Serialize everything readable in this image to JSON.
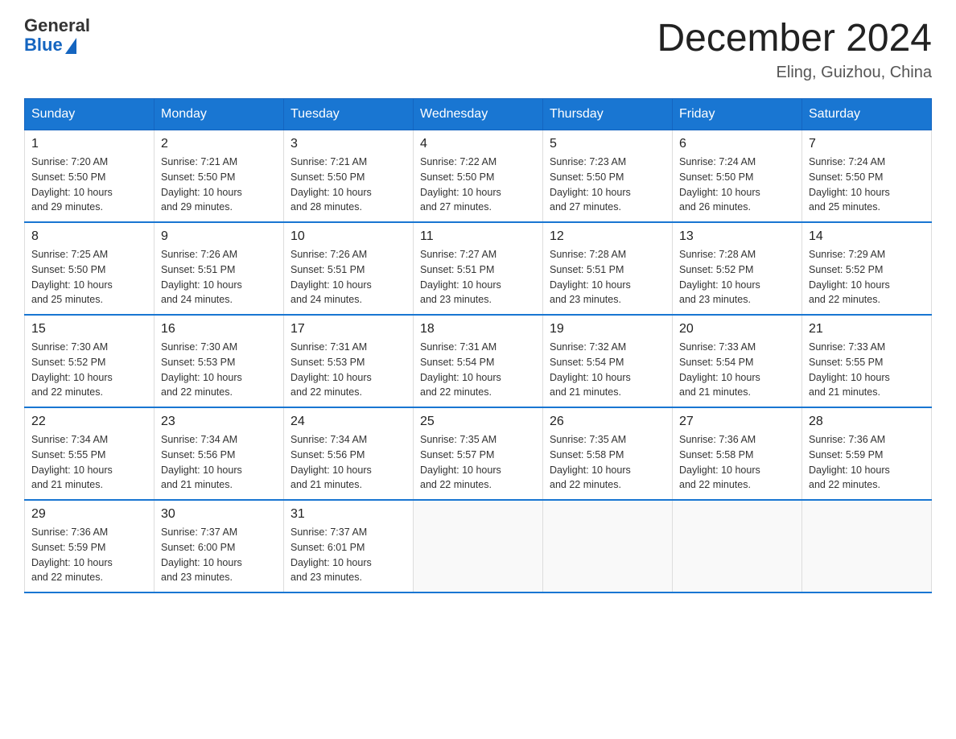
{
  "header": {
    "logo_general": "General",
    "logo_blue": "Blue",
    "month_title": "December 2024",
    "location": "Eling, Guizhou, China"
  },
  "days_of_week": [
    "Sunday",
    "Monday",
    "Tuesday",
    "Wednesday",
    "Thursday",
    "Friday",
    "Saturday"
  ],
  "weeks": [
    [
      {
        "day": "1",
        "sunrise": "7:20 AM",
        "sunset": "5:50 PM",
        "daylight": "10 hours and 29 minutes."
      },
      {
        "day": "2",
        "sunrise": "7:21 AM",
        "sunset": "5:50 PM",
        "daylight": "10 hours and 29 minutes."
      },
      {
        "day": "3",
        "sunrise": "7:21 AM",
        "sunset": "5:50 PM",
        "daylight": "10 hours and 28 minutes."
      },
      {
        "day": "4",
        "sunrise": "7:22 AM",
        "sunset": "5:50 PM",
        "daylight": "10 hours and 27 minutes."
      },
      {
        "day": "5",
        "sunrise": "7:23 AM",
        "sunset": "5:50 PM",
        "daylight": "10 hours and 27 minutes."
      },
      {
        "day": "6",
        "sunrise": "7:24 AM",
        "sunset": "5:50 PM",
        "daylight": "10 hours and 26 minutes."
      },
      {
        "day": "7",
        "sunrise": "7:24 AM",
        "sunset": "5:50 PM",
        "daylight": "10 hours and 25 minutes."
      }
    ],
    [
      {
        "day": "8",
        "sunrise": "7:25 AM",
        "sunset": "5:50 PM",
        "daylight": "10 hours and 25 minutes."
      },
      {
        "day": "9",
        "sunrise": "7:26 AM",
        "sunset": "5:51 PM",
        "daylight": "10 hours and 24 minutes."
      },
      {
        "day": "10",
        "sunrise": "7:26 AM",
        "sunset": "5:51 PM",
        "daylight": "10 hours and 24 minutes."
      },
      {
        "day": "11",
        "sunrise": "7:27 AM",
        "sunset": "5:51 PM",
        "daylight": "10 hours and 23 minutes."
      },
      {
        "day": "12",
        "sunrise": "7:28 AM",
        "sunset": "5:51 PM",
        "daylight": "10 hours and 23 minutes."
      },
      {
        "day": "13",
        "sunrise": "7:28 AM",
        "sunset": "5:52 PM",
        "daylight": "10 hours and 23 minutes."
      },
      {
        "day": "14",
        "sunrise": "7:29 AM",
        "sunset": "5:52 PM",
        "daylight": "10 hours and 22 minutes."
      }
    ],
    [
      {
        "day": "15",
        "sunrise": "7:30 AM",
        "sunset": "5:52 PM",
        "daylight": "10 hours and 22 minutes."
      },
      {
        "day": "16",
        "sunrise": "7:30 AM",
        "sunset": "5:53 PM",
        "daylight": "10 hours and 22 minutes."
      },
      {
        "day": "17",
        "sunrise": "7:31 AM",
        "sunset": "5:53 PM",
        "daylight": "10 hours and 22 minutes."
      },
      {
        "day": "18",
        "sunrise": "7:31 AM",
        "sunset": "5:54 PM",
        "daylight": "10 hours and 22 minutes."
      },
      {
        "day": "19",
        "sunrise": "7:32 AM",
        "sunset": "5:54 PM",
        "daylight": "10 hours and 21 minutes."
      },
      {
        "day": "20",
        "sunrise": "7:33 AM",
        "sunset": "5:54 PM",
        "daylight": "10 hours and 21 minutes."
      },
      {
        "day": "21",
        "sunrise": "7:33 AM",
        "sunset": "5:55 PM",
        "daylight": "10 hours and 21 minutes."
      }
    ],
    [
      {
        "day": "22",
        "sunrise": "7:34 AM",
        "sunset": "5:55 PM",
        "daylight": "10 hours and 21 minutes."
      },
      {
        "day": "23",
        "sunrise": "7:34 AM",
        "sunset": "5:56 PM",
        "daylight": "10 hours and 21 minutes."
      },
      {
        "day": "24",
        "sunrise": "7:34 AM",
        "sunset": "5:56 PM",
        "daylight": "10 hours and 21 minutes."
      },
      {
        "day": "25",
        "sunrise": "7:35 AM",
        "sunset": "5:57 PM",
        "daylight": "10 hours and 22 minutes."
      },
      {
        "day": "26",
        "sunrise": "7:35 AM",
        "sunset": "5:58 PM",
        "daylight": "10 hours and 22 minutes."
      },
      {
        "day": "27",
        "sunrise": "7:36 AM",
        "sunset": "5:58 PM",
        "daylight": "10 hours and 22 minutes."
      },
      {
        "day": "28",
        "sunrise": "7:36 AM",
        "sunset": "5:59 PM",
        "daylight": "10 hours and 22 minutes."
      }
    ],
    [
      {
        "day": "29",
        "sunrise": "7:36 AM",
        "sunset": "5:59 PM",
        "daylight": "10 hours and 22 minutes."
      },
      {
        "day": "30",
        "sunrise": "7:37 AM",
        "sunset": "6:00 PM",
        "daylight": "10 hours and 23 minutes."
      },
      {
        "day": "31",
        "sunrise": "7:37 AM",
        "sunset": "6:01 PM",
        "daylight": "10 hours and 23 minutes."
      },
      null,
      null,
      null,
      null
    ]
  ],
  "labels": {
    "sunrise": "Sunrise:",
    "sunset": "Sunset:",
    "daylight": "Daylight:"
  }
}
